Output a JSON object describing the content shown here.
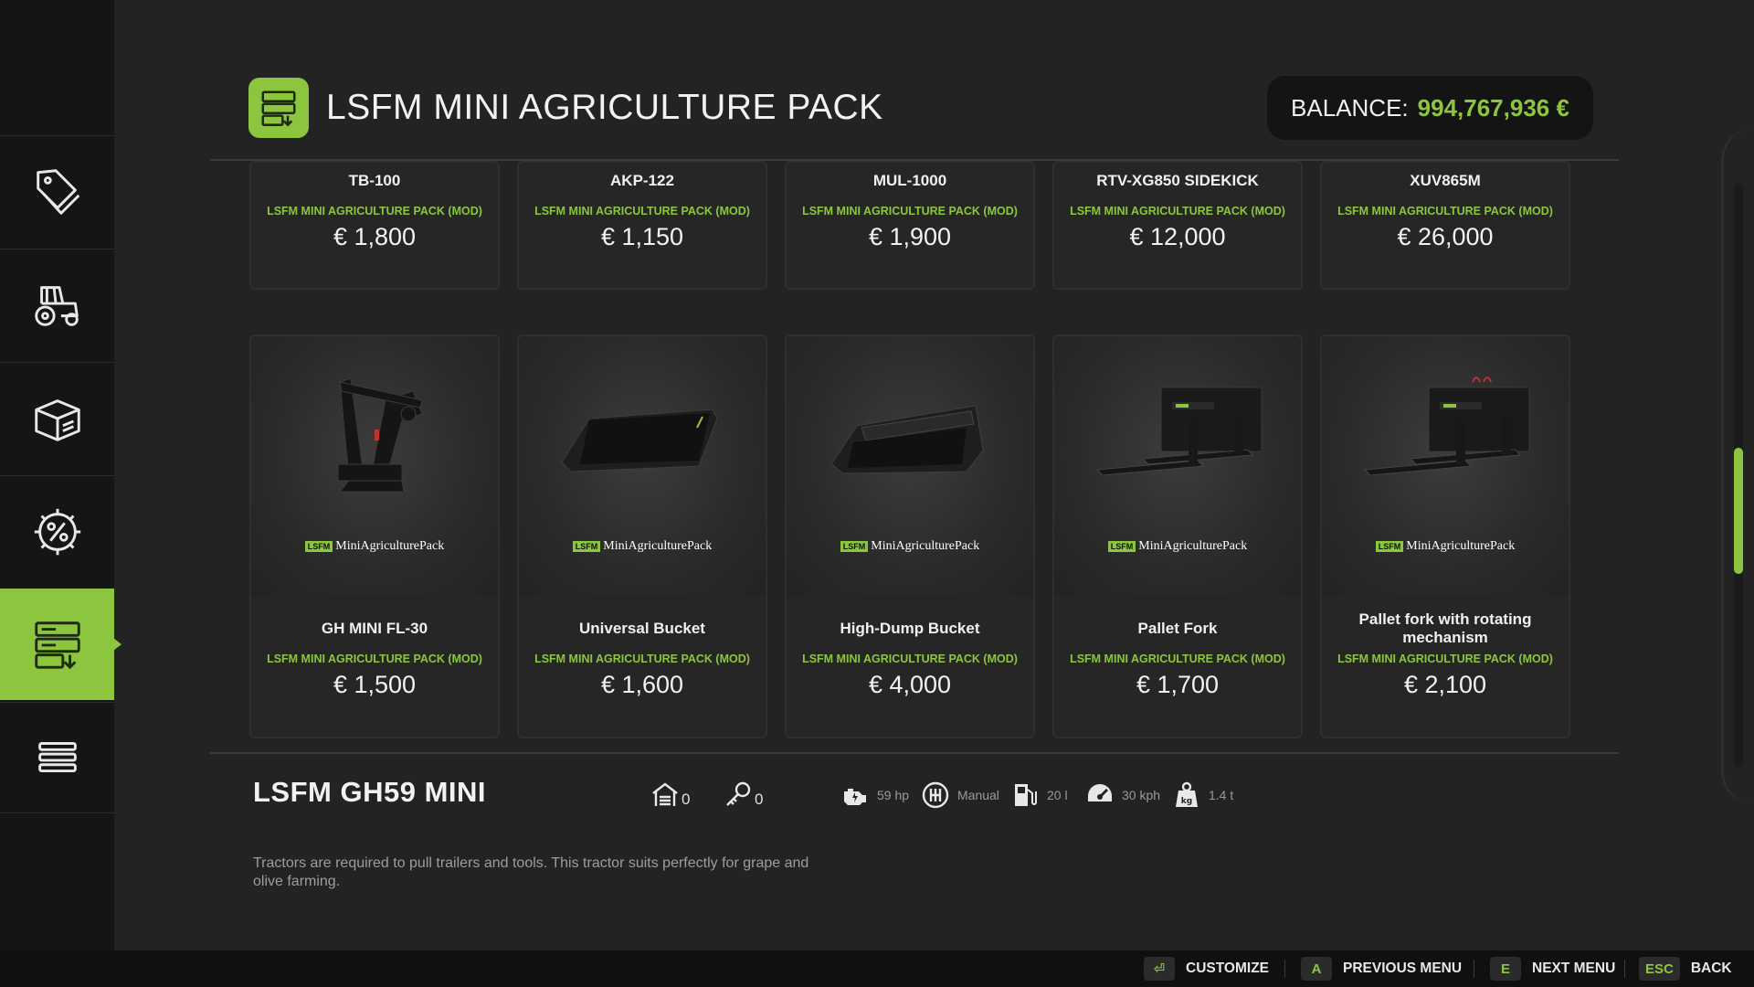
{
  "header": {
    "title": "LSFM MINI AGRICULTURE PACK",
    "balance_label": "BALANCE:",
    "balance_value": "994,767,936 €"
  },
  "sidebar": {
    "items": [
      {
        "icon": "price-tags-icon"
      },
      {
        "icon": "tractor-icon"
      },
      {
        "icon": "box-icon"
      },
      {
        "icon": "percent-gear-icon"
      },
      {
        "icon": "mod-storage-icon",
        "active": true
      },
      {
        "icon": "menu-list-icon"
      }
    ]
  },
  "row1": [
    {
      "name": "TB-100",
      "source": "LSFM MINI AGRICULTURE PACK (MOD)",
      "price": "€ 1,800"
    },
    {
      "name": "AKP-122",
      "source": "LSFM MINI AGRICULTURE PACK (MOD)",
      "price": "€ 1,150"
    },
    {
      "name": "MUL-1000",
      "source": "LSFM MINI AGRICULTURE PACK (MOD)",
      "price": "€ 1,900"
    },
    {
      "name": "RTV-XG850 SIDEKICK",
      "source": "LSFM MINI AGRICULTURE PACK (MOD)",
      "price": "€ 12,000"
    },
    {
      "name": "XUV865M",
      "source": "LSFM MINI AGRICULTURE PACK (MOD)",
      "price": "€ 26,000"
    }
  ],
  "row2": [
    {
      "name": "GH MINI FL-30",
      "source": "LSFM MINI AGRICULTURE PACK (MOD)",
      "price": "€ 1,500",
      "brand_tag": "LSFM",
      "brand": "MiniAgriculturePack"
    },
    {
      "name": "Universal Bucket",
      "source": "LSFM MINI AGRICULTURE PACK (MOD)",
      "price": "€ 1,600",
      "brand_tag": "LSFM",
      "brand": "MiniAgriculturePack"
    },
    {
      "name": "High-Dump Bucket",
      "source": "LSFM MINI AGRICULTURE PACK (MOD)",
      "price": "€ 4,000",
      "brand_tag": "LSFM",
      "brand": "MiniAgriculturePack"
    },
    {
      "name": "Pallet Fork",
      "source": "LSFM MINI AGRICULTURE PACK (MOD)",
      "price": "€ 1,700",
      "brand_tag": "LSFM",
      "brand": "MiniAgriculturePack"
    },
    {
      "name": "Pallet fork with rotating mechanism",
      "source": "LSFM MINI AGRICULTURE PACK (MOD)",
      "price": "€ 2,100",
      "brand_tag": "LSFM",
      "brand": "MiniAgriculturePack"
    }
  ],
  "detail": {
    "title": "LSFM GH59 MINI",
    "owned": "0",
    "leased": "0",
    "power": "59 hp",
    "transmission": "Manual",
    "fuel": "20 l",
    "speed": "30 kph",
    "weight": "1.4 t",
    "description": "Tractors are required to pull trailers and tools. This tractor suits perfectly for grape and olive farming."
  },
  "bottombar": {
    "customize_label": "CUSTOMIZE",
    "prev_key": "A",
    "prev_label": "PREVIOUS MENU",
    "next_key": "E",
    "next_label": "NEXT MENU",
    "back_key": "ESC",
    "back_label": "BACK"
  },
  "colors": {
    "accent": "#8cc63f",
    "background": "#232323",
    "sidebar": "#151515"
  }
}
